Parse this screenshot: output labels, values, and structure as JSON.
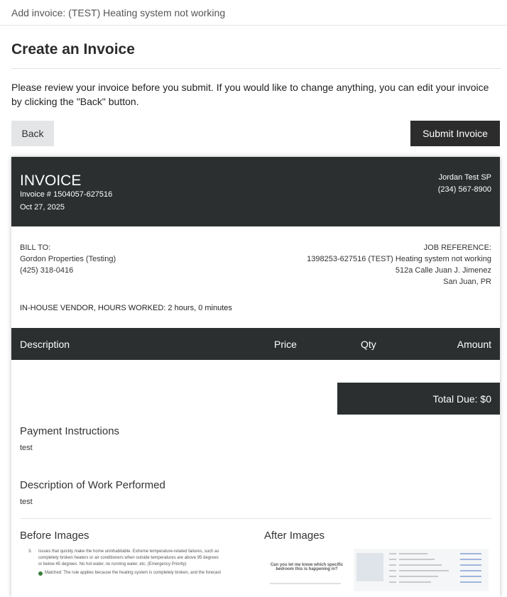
{
  "topbar": {
    "title": "Add invoice: (TEST) Heating system not working"
  },
  "page": {
    "heading": "Create an Invoice",
    "intro": "Please review your invoice before you submit. If you would like to change anything, you can edit your invoice by clicking the \"Back\" button."
  },
  "buttons": {
    "back": "Back",
    "submit": "Submit Invoice"
  },
  "invoice": {
    "title": "INVOICE",
    "number": "Invoice # 1504057-627516",
    "date": "Oct 27, 2025",
    "vendor": {
      "name": "Jordan Test SP",
      "phone": "(234) 567-8900"
    },
    "bill_to": {
      "label": "BILL TO:",
      "name": "Gordon Properties (Testing)",
      "phone": "(425) 318-0416"
    },
    "job_reference": {
      "label": "JOB REFERENCE:",
      "line1": "1398253-627516 (TEST) Heating system not working",
      "line2": "512a Calle Juan J. Jimenez",
      "line3": "San Juan, PR"
    },
    "hours_worked": "IN-HOUSE VENDOR, HOURS WORKED: 2 hours, 0 minutes",
    "table": {
      "description": "Description",
      "price": "Price",
      "qty": "Qty",
      "amount": "Amount"
    },
    "total_due": "Total Due: $0",
    "payment_instructions": {
      "title": "Payment Instructions",
      "text": "test"
    },
    "work_description": {
      "title": "Description of Work Performed",
      "text": "test"
    },
    "before_images": "Before Images",
    "after_images": "After Images"
  },
  "thumbnails": {
    "before_item": "3.",
    "before_line1": "Issues that quickly make the home uninhabitable. Extreme temperature-related failures, such as",
    "before_line2": "completely broken heaters or air conditioners when outside temperatures are above 95 degrees",
    "before_line3": "or below 45 degrees. No hot water, no running water, etc. (Emergency Priority)",
    "before_matched": "Matched: The rule applies because the heating system is completely broken, and the forecast",
    "after_question": "Can you let me know which specific bedroom this is happening in?"
  },
  "colors": {
    "dark": "#2b2f30",
    "button_gray": "#e4e5e7",
    "submit": "#2c2c2c"
  }
}
